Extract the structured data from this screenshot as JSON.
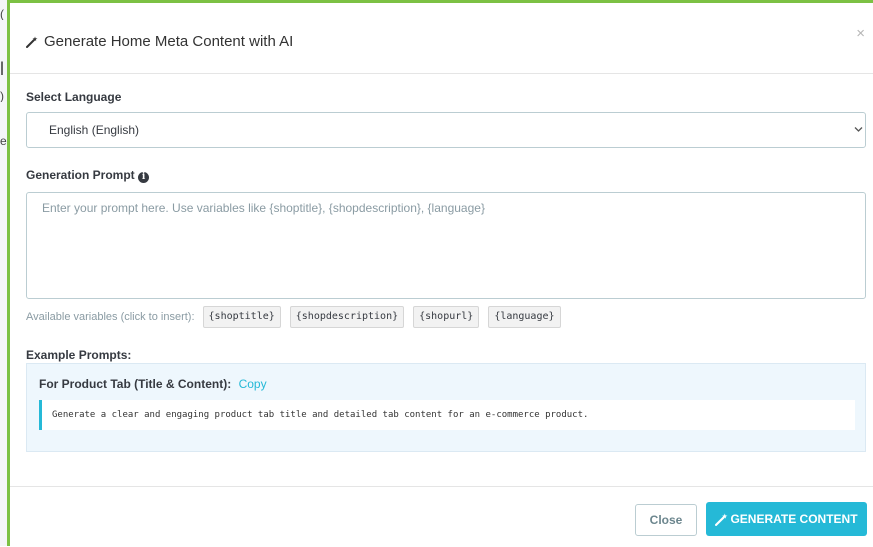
{
  "modal": {
    "title": "Generate Home Meta Content with AI",
    "title_icon": "magic-wand-icon",
    "close_symbol": "×"
  },
  "language": {
    "label": "Select Language",
    "selected": "English (English)"
  },
  "prompt": {
    "label": "Generation Prompt",
    "placeholder": "Enter your prompt here. Use variables like {shoptitle}, {shopdescription}, {language}",
    "value": ""
  },
  "variables": {
    "label": "Available variables (click to insert):",
    "items": [
      "{shoptitle}",
      "{shopdescription}",
      "{shopurl}",
      "{language}"
    ]
  },
  "examples": {
    "heading": "Example Prompts:",
    "items": [
      {
        "title": "For Product Tab (Title & Content):",
        "copy_label": "Copy",
        "text": "Generate a clear and engaging product tab title and detailed tab content for an e-commerce product."
      }
    ]
  },
  "footer": {
    "close_label": "Close",
    "generate_label": "GENERATE CONTENT"
  },
  "colors": {
    "accent": "#25b9d7",
    "page_edge": "#7cc144"
  }
}
